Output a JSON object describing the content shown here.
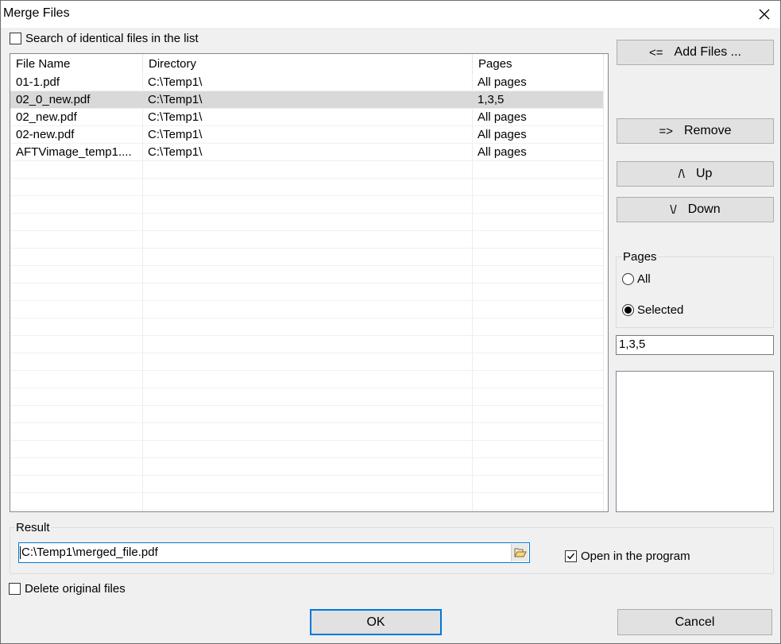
{
  "window": {
    "title": "Merge Files"
  },
  "search_identical": {
    "label": "Search of identical files in the list",
    "checked": false
  },
  "file_list": {
    "columns": [
      "File Name",
      "Directory",
      "Pages"
    ],
    "rows": [
      {
        "name": "01-1.pdf",
        "dir": "C:\\Temp1\\",
        "pages": "All pages",
        "selected": false
      },
      {
        "name": "02_0_new.pdf",
        "dir": "C:\\Temp1\\",
        "pages": "1,3,5",
        "selected": true
      },
      {
        "name": "02_new.pdf",
        "dir": "C:\\Temp1\\",
        "pages": "All pages",
        "selected": false
      },
      {
        "name": "02-new.pdf",
        "dir": "C:\\Temp1\\",
        "pages": "All pages",
        "selected": false
      },
      {
        "name": "AFTVimage_temp1....",
        "dir": "C:\\Temp1\\",
        "pages": "All pages",
        "selected": false
      }
    ]
  },
  "buttons": {
    "add_files": {
      "glyph": "<=",
      "label": "Add Files ..."
    },
    "remove": {
      "glyph": "=>",
      "label": "Remove"
    },
    "up": {
      "glyph": "/\\",
      "label": "Up"
    },
    "down": {
      "glyph": "\\/",
      "label": "Down"
    }
  },
  "pages_group": {
    "label": "Pages",
    "all_label": "All",
    "selected_label": "Selected",
    "selected_option": "Selected",
    "pages_value": "1,3,5"
  },
  "result": {
    "label": "Result",
    "path": "C:\\Temp1\\merged_file.pdf",
    "open_in_program": {
      "label": "Open in the program",
      "checked": true
    }
  },
  "delete_original": {
    "label": "Delete original files",
    "checked": false
  },
  "footer": {
    "ok_label": "OK",
    "cancel_label": "Cancel"
  },
  "icons": {
    "close": "close-icon",
    "browse": "folder-open-icon",
    "check": "checkmark-icon"
  }
}
